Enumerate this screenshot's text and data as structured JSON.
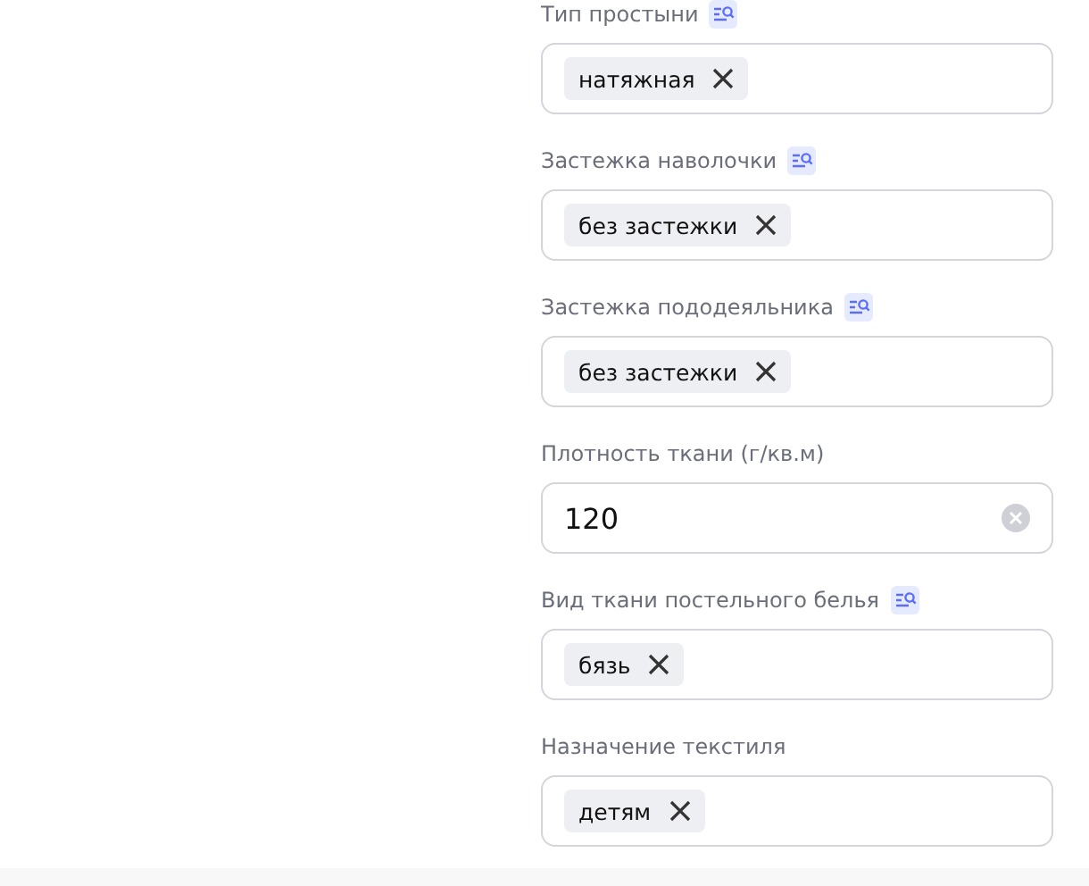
{
  "fields": [
    {
      "label": "Тип простыни",
      "has_filter_icon": true,
      "kind": "chips",
      "chips": [
        "натяжная"
      ]
    },
    {
      "label": "Застежка наволочки",
      "has_filter_icon": true,
      "kind": "chips",
      "chips": [
        "без застежки"
      ]
    },
    {
      "label": "Застежка пододеяльника",
      "has_filter_icon": true,
      "kind": "chips",
      "chips": [
        "без застежки"
      ]
    },
    {
      "label": "Плотность ткани (г/кв.м)",
      "has_filter_icon": false,
      "kind": "text",
      "value": "120"
    },
    {
      "label": "Вид ткани постельного белья",
      "has_filter_icon": true,
      "kind": "chips",
      "chips": [
        "бязь"
      ]
    },
    {
      "label": "Назначение текстиля",
      "has_filter_icon": false,
      "kind": "chips",
      "chips": [
        "детям"
      ]
    }
  ]
}
